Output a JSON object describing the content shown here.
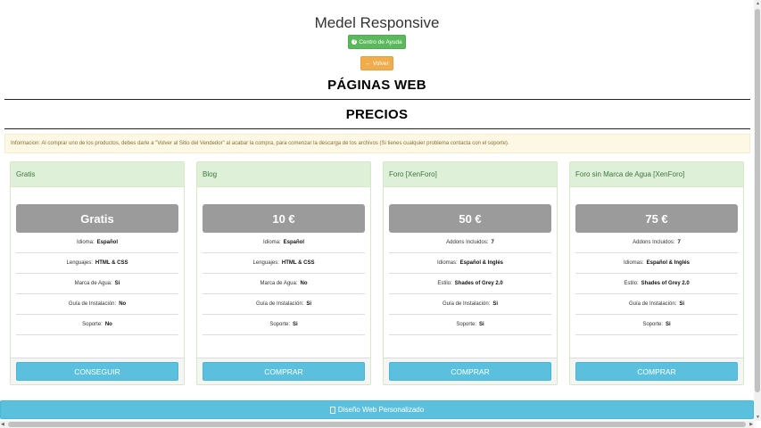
{
  "header": {
    "title": "Medel Responsive",
    "help_label": "Centro de Ayuda",
    "back_label": "Volver",
    "section1": "PÁGINAS WEB",
    "section2": "PRECIOS"
  },
  "alert": {
    "text": "Informacion: Al comprar uno de los productos, debes darle a \"Volver al Sitio del Vendedor\" al acabar la compra, para comenzar la descarga de los archivos (Si tienes cualquier problema contacta con el soporte)."
  },
  "plans": [
    {
      "name": "Gratis",
      "price": "Gratis",
      "features": [
        {
          "label": "Idioma:",
          "value": "Español"
        },
        {
          "label": "Lenguajes:",
          "value": "HTML & CSS"
        },
        {
          "label": "Marca de Agua:",
          "value": "Si"
        },
        {
          "label": "Guía de Instalación:",
          "value": "No"
        },
        {
          "label": "Soporte:",
          "value": "No"
        }
      ],
      "button": "CONSEGUIR"
    },
    {
      "name": "Blog",
      "price": "10 €",
      "features": [
        {
          "label": "Idioma:",
          "value": "Español"
        },
        {
          "label": "Lenguajes:",
          "value": "HTML & CSS"
        },
        {
          "label": "Marca de Agua:",
          "value": "No"
        },
        {
          "label": "Guía de Instalación:",
          "value": "Si"
        },
        {
          "label": "Soporte:",
          "value": "Si"
        }
      ],
      "button": "COMPRAR"
    },
    {
      "name": "Foro [XenForo]",
      "price": "50 €",
      "features": [
        {
          "label": "Addons Incluidos:",
          "value": "7"
        },
        {
          "label": "Idiomas:",
          "value": "Español & Inglés"
        },
        {
          "label": "Estilo:",
          "value": "Shades of Grey 2.0"
        },
        {
          "label": "Guía de Instalación:",
          "value": "Si"
        },
        {
          "label": "Soporte:",
          "value": "Si"
        }
      ],
      "button": "COMPRAR"
    },
    {
      "name": "Foro sin Marca de Agua [XenForo]",
      "price": "75 €",
      "features": [
        {
          "label": "Addons Incluidos:",
          "value": "7"
        },
        {
          "label": "Idiomas:",
          "value": "Español & Inglés"
        },
        {
          "label": "Estilo:",
          "value": "Shades of Grey 2.0"
        },
        {
          "label": "Guía de Instalación:",
          "value": "Si"
        },
        {
          "label": "Soporte:",
          "value": "Si"
        }
      ],
      "button": "COMPRAR"
    }
  ],
  "footer": {
    "custom_label": "Diseño Web Personalizado"
  },
  "colors": {
    "success": "#5cb85c",
    "warning": "#f0ad4e",
    "info": "#5bc0de",
    "panel_header": "#dff0d8",
    "price_box": "#9b9b9b"
  },
  "icons": {
    "help": "question-circle-icon",
    "back": "arrow-left-icon",
    "custom": "file-icon"
  }
}
